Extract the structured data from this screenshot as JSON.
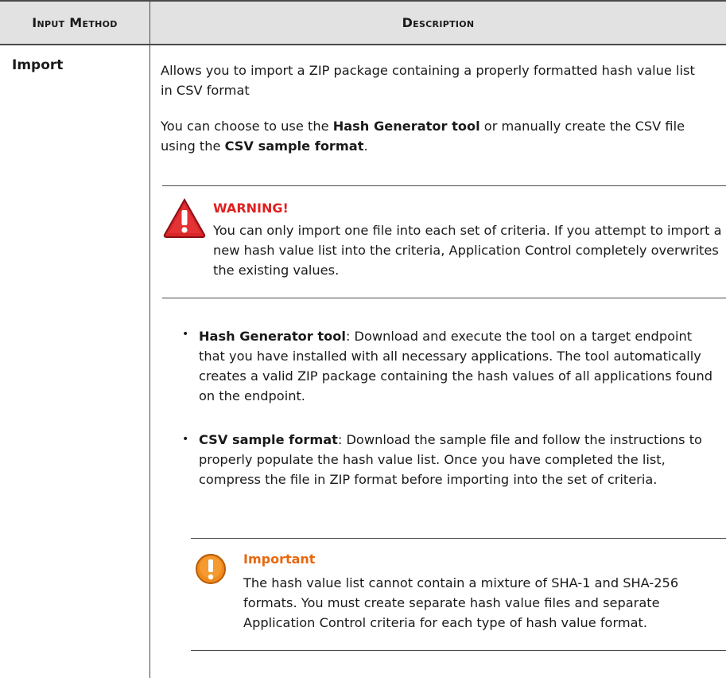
{
  "table": {
    "headers": {
      "method": "Input Method",
      "description": "Description"
    },
    "row": {
      "method": "Import",
      "para1": "Allows you to import a ZIP package containing a properly formatted hash value list in CSV format",
      "para2": {
        "prefix": "You can choose to use the ",
        "bold1": "Hash Generator tool",
        "middle": " or manually create the CSV file using the ",
        "bold2": "CSV sample format",
        "suffix": "."
      },
      "warning": {
        "title": "WARNING!",
        "body": "You can only import one file into each set of criteria. If you attempt to import a new hash value list into the criteria, Application Control completely overwrites the existing values.",
        "color": "#e02020"
      },
      "bullets": [
        {
          "term": "Hash Generator tool",
          "text": ": Download and execute the tool on a target endpoint that you have installed with all necessary applications. The tool automatically creates a valid ZIP package containing the hash values of all applications found on the endpoint."
        },
        {
          "term": "CSV sample format",
          "text": ": Download the sample file and follow the instructions to properly populate the hash value list. Once you have completed the list, compress the file in ZIP format before importing into the set of criteria."
        }
      ],
      "important": {
        "title": "Important",
        "body": "The hash value list cannot contain a mixture of SHA-1 and SHA-256 formats. You must create separate hash value files and separate Application Control criteria for each type of hash value format.",
        "color": "#e8680e"
      }
    }
  },
  "icons": {
    "warning": "warning-triangle-icon",
    "important": "important-exclamation-icon"
  }
}
